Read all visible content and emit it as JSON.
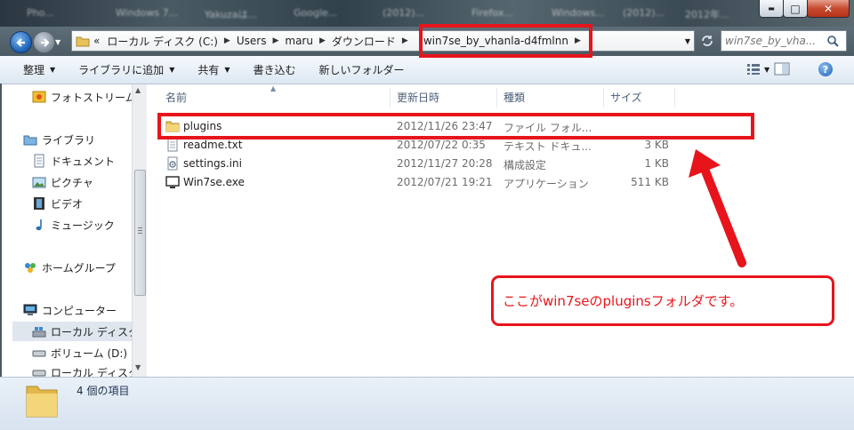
{
  "window": {
    "blurred_titles": [
      "Pho...",
      "Windows 7...",
      "Yakuzaは...",
      "Google...",
      "(2012)...",
      "Firefox...",
      "Windows...",
      "(2012)...",
      "2012年..."
    ],
    "controls": {
      "minimize": "▬",
      "maximize": "□",
      "close": "✕"
    }
  },
  "address": {
    "overflow": "«",
    "crumbs": [
      "ローカル ディスク (C:)",
      "Users",
      "maru",
      "ダウンロード",
      "win7se_by_vhanla-d4fmlnn"
    ],
    "search_placeholder": "win7se_by_vha..."
  },
  "toolbar": {
    "organize": "整理",
    "add_library": "ライブラリに追加",
    "share": "共有",
    "burn": "書き込む",
    "new_folder": "新しいフォルダー"
  },
  "nav": {
    "items": [
      {
        "label": "フォトストリーム",
        "icon": "photostream-icon"
      },
      {
        "label": "ライブラリ",
        "icon": "library-icon"
      },
      {
        "label": "ドキュメント",
        "icon": "document-icon"
      },
      {
        "label": "ピクチャ",
        "icon": "picture-icon"
      },
      {
        "label": "ビデオ",
        "icon": "video-icon"
      },
      {
        "label": "ミュージック",
        "icon": "music-icon"
      },
      {
        "label": "ホームグループ",
        "icon": "homegroup-icon"
      },
      {
        "label": "コンピューター",
        "icon": "computer-icon"
      },
      {
        "label": "ローカル ディスク (C:)",
        "icon": "local-disk-icon"
      },
      {
        "label": "ボリューム (D:)",
        "icon": "volume-icon"
      },
      {
        "label": "ローカル ディスク",
        "icon": "local-disk-icon"
      }
    ]
  },
  "columns": {
    "name": "名前",
    "modified": "更新日時",
    "type": "種類",
    "size": "サイズ"
  },
  "files": [
    {
      "name": "plugins",
      "modified": "2012/11/26 23:47",
      "type": "ファイル フォル...",
      "size": "",
      "icon": "folder-icon"
    },
    {
      "name": "readme.txt",
      "modified": "2012/07/22 0:35",
      "type": "テキスト ドキュ...",
      "size": "3 KB",
      "icon": "text-file-icon"
    },
    {
      "name": "settings.ini",
      "modified": "2012/11/27 20:28",
      "type": "構成設定",
      "size": "1 KB",
      "icon": "settings-file-icon"
    },
    {
      "name": "Win7se.exe",
      "modified": "2012/07/21 19:21",
      "type": "アプリケーション",
      "size": "511 KB",
      "icon": "exe-icon"
    }
  ],
  "status": {
    "count": "4 個の項目"
  },
  "annotation": {
    "text": "ここがwin7seのpluginsフォルダです。",
    "color": "#e8141b"
  }
}
